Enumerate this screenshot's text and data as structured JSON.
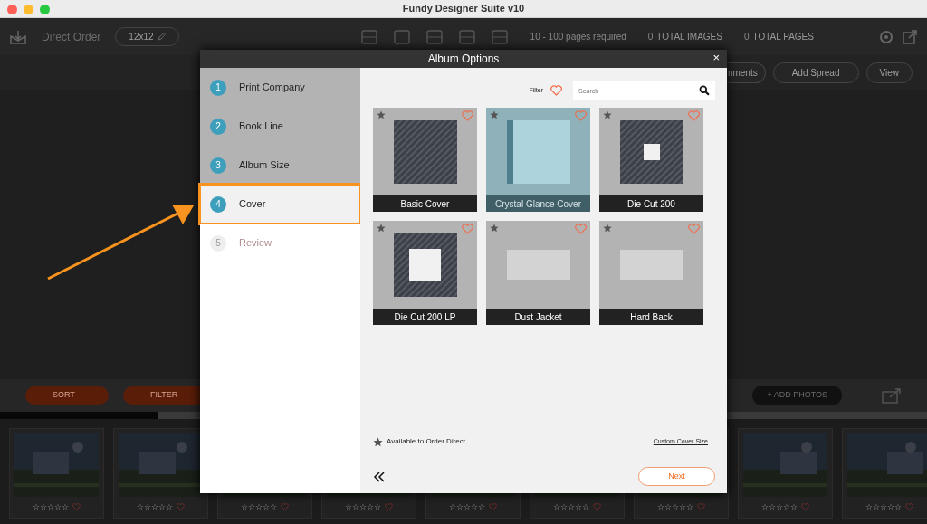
{
  "window": {
    "title": "Fundy Designer Suite v10"
  },
  "toolbar": {
    "title": "Direct Order",
    "album_size": "12x12",
    "pages_required": "10 - 100 pages required",
    "image_count": "0",
    "images_label": "TOTAL IMAGES",
    "page_count": "0",
    "pages_label": "TOTAL PAGES"
  },
  "spread_actions": [
    "mments",
    "Add Spread",
    "View"
  ],
  "photo_bar": {
    "sort": "SORT",
    "filter": "FILTER",
    "add_photos": "+ ADD PHOTOS",
    "progress": {
      "level": 0.17
    }
  },
  "photos": [
    {
      "stars": 0
    },
    {
      "stars": 0
    },
    {
      "stars": 0
    },
    {
      "stars": 0
    },
    {
      "stars": 0
    },
    {
      "stars": 0
    },
    {
      "stars": 0
    },
    {
      "stars": 0
    },
    {
      "stars": 0
    }
  ],
  "dialog": {
    "title": "Album Options",
    "close": "×",
    "steps": [
      {
        "number": "1",
        "label": "Print Company",
        "completed": true,
        "selected": false,
        "disabled": false,
        "highlighted": false
      },
      {
        "number": "2",
        "label": "Book Line",
        "completed": true,
        "selected": false,
        "disabled": false,
        "highlighted": false
      },
      {
        "number": "3",
        "label": "Album Size",
        "completed": true,
        "selected": false,
        "disabled": false,
        "highlighted": false
      },
      {
        "number": "4",
        "label": "Cover",
        "completed": false,
        "selected": true,
        "disabled": false,
        "highlighted": true
      },
      {
        "number": "5",
        "label": "Review",
        "completed": false,
        "selected": false,
        "disabled": true,
        "highlighted": false
      }
    ],
    "filter_label": "Filter",
    "search": {
      "placeholder": "Search"
    },
    "covers": [
      {
        "name": "Basic Cover",
        "kind": "hatch",
        "selected": false
      },
      {
        "name": "Crystal Glance Cover",
        "kind": "glass",
        "selected": true
      },
      {
        "name": "Die Cut 200",
        "kind": "window-small",
        "selected": false
      },
      {
        "name": "Die Cut 200 LP",
        "kind": "window-large",
        "selected": false
      },
      {
        "name": "Dust Jacket",
        "kind": "panel",
        "selected": false
      },
      {
        "name": "Hard Back",
        "kind": "panel",
        "selected": false
      }
    ],
    "legend": "Available to Order Direct",
    "custom_link": "Custom Cover Size",
    "next": "Next"
  }
}
